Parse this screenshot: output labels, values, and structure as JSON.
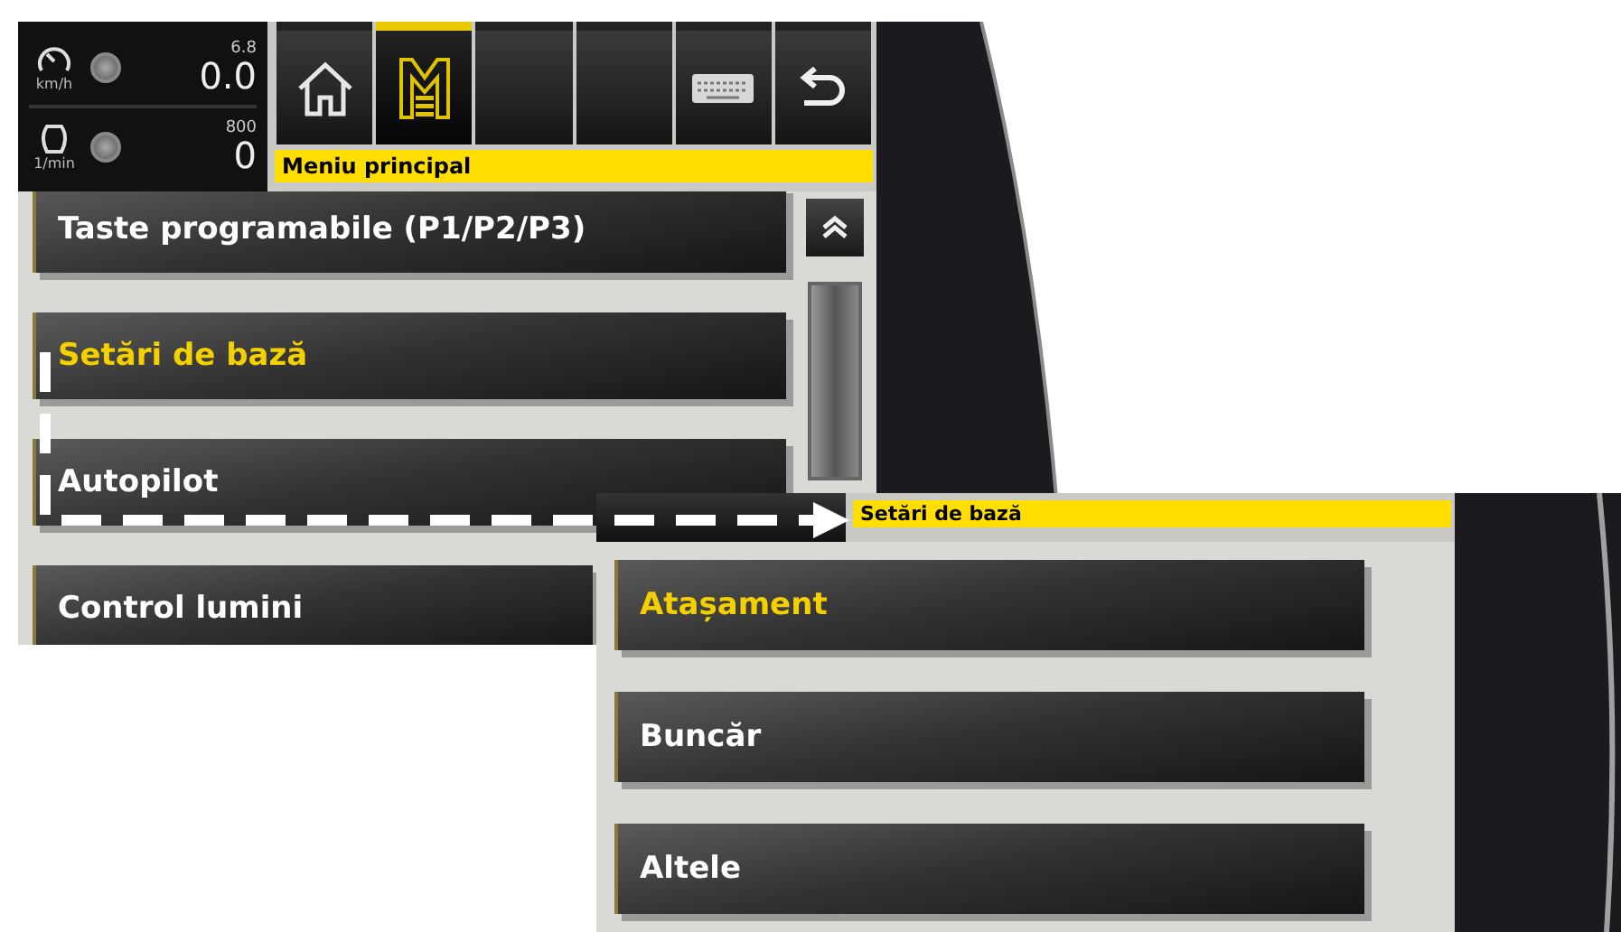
{
  "screens": [
    {
      "gauges": [
        {
          "kind": "speed",
          "max": "6.8",
          "value": "0.0",
          "unit": "km/h"
        },
        {
          "kind": "engine",
          "max": "800",
          "value": "0",
          "unit": "1/min"
        }
      ],
      "toolbar": [
        {
          "kind": "home",
          "selected": false
        },
        {
          "kind": "menu",
          "selected": true
        },
        {
          "kind": "blank",
          "selected": false
        },
        {
          "kind": "blank",
          "selected": false
        },
        {
          "kind": "keyboard",
          "selected": false
        },
        {
          "kind": "back",
          "selected": false
        }
      ],
      "title": "Meniu principal",
      "menu_items": [
        {
          "label": "Taste programabile (P1/P2/P3)",
          "selected": false
        },
        {
          "label": "Setări de bază",
          "selected": true
        },
        {
          "label": "Autopilot",
          "selected": false
        },
        {
          "label": "Control lumini",
          "selected": false
        }
      ]
    },
    {
      "title": "Setări de bază",
      "menu_items": [
        {
          "label": "Atașament",
          "selected": true
        },
        {
          "label": "Buncăr",
          "selected": false
        },
        {
          "label": "Altele",
          "selected": false
        }
      ]
    }
  ]
}
